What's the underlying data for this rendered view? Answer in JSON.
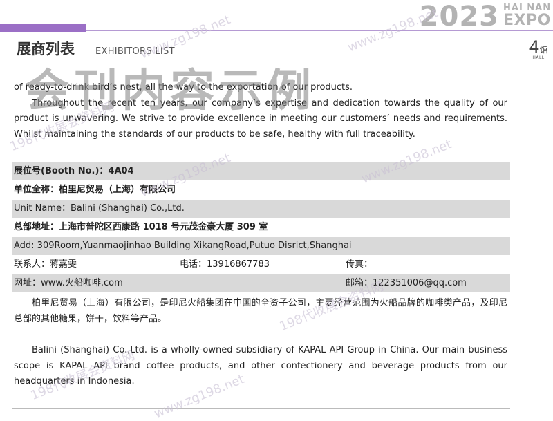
{
  "header": {
    "year": "2023",
    "brand_top": "HAI NAN",
    "brand_bottom": "EXPO",
    "title_cn": "展商列表",
    "title_en": "EXHIBITORS LIST",
    "hall_number": "4",
    "hall_cn": "馆",
    "hall_en": "HALL"
  },
  "prev_text": {
    "line1": "of ready-to-drink bird’s nest, all the way to the exportation of our products.",
    "para2": "Throughout the recent ten years, our company’s expertise and dedication towards the quality of our product is unwavering. We strive to provide excellence in meeting our customers’ needs and requirements. Whilst maintaining the standards of our products to be safe, healthy with full traceability."
  },
  "exhibitor": {
    "booth": "展位号(Booth No.)：4A04",
    "name_cn": "单位全称：柏里尼贸易（上海）有限公司",
    "name_en": "Unit Name：Balini (Shanghai) Co.,Ltd.",
    "address_cn": "总部地址：上海市普陀区西康路 1018 号元茂金豪大厦 309 室",
    "address_en": "Add: 309Room,Yuanmaojinhao Building XikangRoad,Putuo Disrict,Shanghai",
    "contact": "联系人：蒋嘉雯",
    "phone": "电话：13916867783",
    "fax": "传真：",
    "website": "网址：www.火船咖啡.com",
    "email": "邮箱：122351006@qq.com",
    "desc_cn": "柏里尼贸易（上海）有限公司，是印尼火船集团在中国的全资子公司，主要经营范围为火船品牌的咖啡类产品，及印尼总部的其他糖果，饼干，饮料等产品。",
    "desc_en": "Balini (Shanghai) Co.,Ltd. is a wholly-owned subsidiary of KAPAL API Group in China. Our main business scope is KAPAL API brand coffee products, and other confectionery and beverage products from our headquarters in Indonesia."
  },
  "watermark": {
    "big": "会刊内容示例",
    "site": "www.zg198.net",
    "service": "198代收展会资料网"
  },
  "colors": {
    "accent_purple": "#9b6fc6",
    "row_shade": "#d9d9d9",
    "brand_gray": "#b3b3b3"
  }
}
